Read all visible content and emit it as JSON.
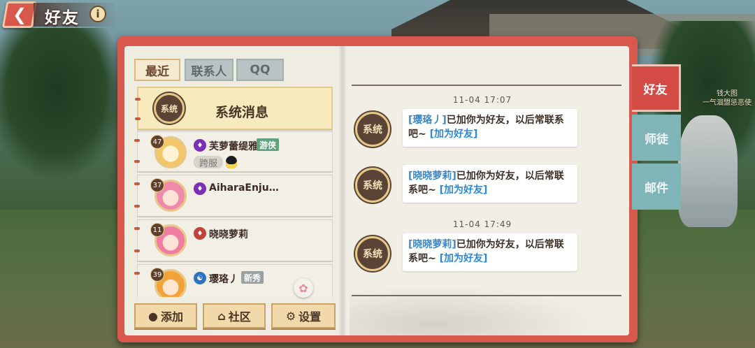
{
  "header": {
    "title": "好友",
    "back_icon": "arrow-left-icon",
    "info_icon": "info-icon"
  },
  "tabs": [
    "最近",
    "联系人",
    "QQ"
  ],
  "system_row": {
    "seal": "系统",
    "title": "系统消息"
  },
  "friends": [
    {
      "level": "47",
      "name": "芙萝蕾缇雅",
      "badge": "游侠",
      "cross_server": "跨服",
      "vip_icon": "vip-purple"
    },
    {
      "level": "37",
      "name": "AiharaEnju…",
      "vip_icon": "vip-purple"
    },
    {
      "level": "11",
      "name": "晓晓萝莉",
      "vip_icon": "vip-red"
    },
    {
      "level": "39",
      "name": "璎珞丿",
      "badge": "新秀",
      "vip_icon": "vip-blue"
    }
  ],
  "bottom_buttons": {
    "add": "添加",
    "community": "社区",
    "settings": "设置"
  },
  "messages": [
    {
      "time": "11-04 17:07",
      "seal": "系统",
      "who": "[璎珞丿]",
      "text": "已加你为好友，以后常联系吧~",
      "action": "[加为好友]"
    },
    {
      "time": "",
      "seal": "系统",
      "who": "[晓晓萝莉]",
      "text": "已加你为好友，以后常联系吧~",
      "action": "[加为好友]"
    },
    {
      "time": "11-04 17:49",
      "seal": "系统",
      "who": "[晓晓萝莉]",
      "text": "已加你为好友，以后常联系吧~",
      "action": "[加为好友]"
    }
  ],
  "side_tabs": [
    "好友",
    "师徒",
    "邮件"
  ],
  "npc": {
    "name": "钱大图",
    "subtitle": "一气涸盟惩恶使"
  },
  "colors": {
    "book_red": "#d9584e",
    "active_tab": "#d44a45",
    "inactive_tab": "#80b5b8",
    "link_blue": "#2a88d6"
  }
}
